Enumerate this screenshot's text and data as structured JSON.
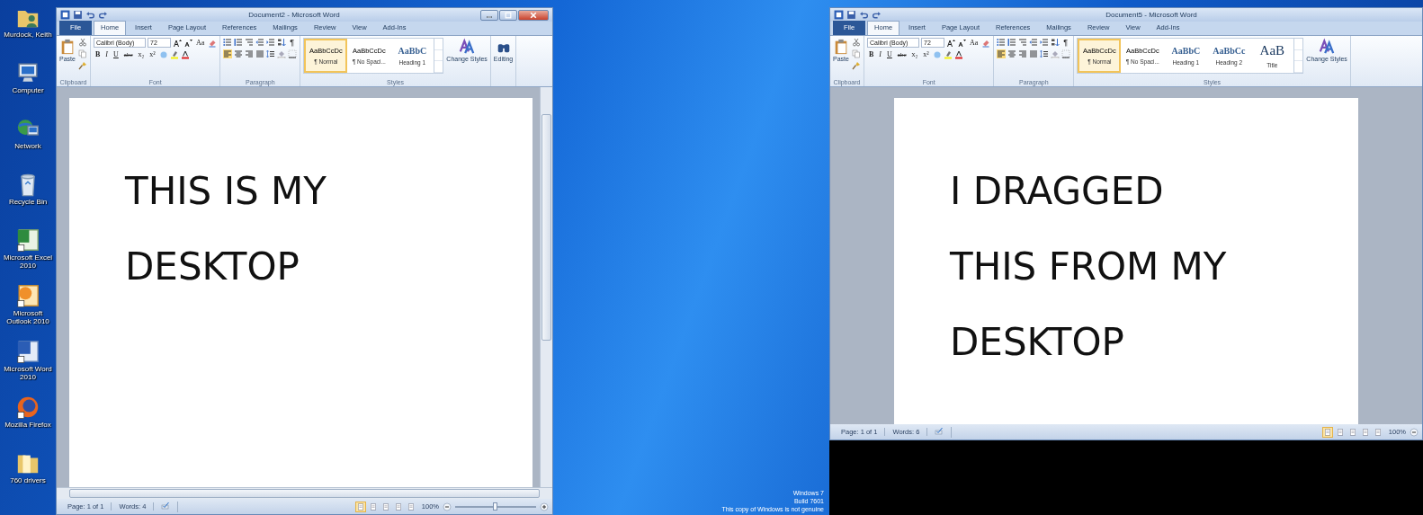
{
  "desktop": {
    "icons": [
      {
        "label": "Murdock, Keith",
        "kind": "user"
      },
      {
        "label": "Computer",
        "kind": "computer"
      },
      {
        "label": "Network",
        "kind": "network"
      },
      {
        "label": "Recycle Bin",
        "kind": "bin"
      },
      {
        "label": "Microsoft Excel 2010",
        "kind": "excel"
      },
      {
        "label": "Microsoft Outlook 2010",
        "kind": "outlook"
      },
      {
        "label": "Microsoft Word 2010",
        "kind": "word"
      },
      {
        "label": "Mozilla Firefox",
        "kind": "firefox"
      },
      {
        "label": "760 drivers",
        "kind": "folder"
      }
    ],
    "system_notice": [
      "Windows 7",
      "Build 7601",
      "This copy of Windows is not genuine"
    ]
  },
  "windows": [
    {
      "title": "Document2 - Microsoft Word",
      "window_buttons": true,
      "scrollbars": true,
      "tabs": [
        {
          "label": "File",
          "kind": "file",
          "selected": false
        },
        {
          "label": "Home",
          "kind": "tab",
          "selected": true
        },
        {
          "label": "Insert",
          "kind": "tab",
          "selected": false
        },
        {
          "label": "Page Layout",
          "kind": "tab",
          "selected": false
        },
        {
          "label": "References",
          "kind": "tab",
          "selected": false
        },
        {
          "label": "Mailings",
          "kind": "tab",
          "selected": false
        },
        {
          "label": "Review",
          "kind": "tab",
          "selected": false
        },
        {
          "label": "View",
          "kind": "tab",
          "selected": false
        },
        {
          "label": "Add-Ins",
          "kind": "tab",
          "selected": false
        }
      ],
      "ribbon": {
        "paste": "Paste",
        "font_name": "Calibri (Body)",
        "font_size": "72",
        "change_case": "Aa",
        "format_buttons": [
          "B",
          "I",
          "U",
          "abc",
          "x₂",
          "x²"
        ],
        "paragraph_mark": "¶",
        "styles": [
          {
            "preview": "AaBbCcDc",
            "name": "¶ Normal",
            "kind": "normal",
            "selected": true
          },
          {
            "preview": "AaBbCcDc",
            "name": "¶ No Spaci...",
            "kind": "normal",
            "selected": false
          },
          {
            "preview": "AaBbC",
            "name": "Heading 1",
            "kind": "heading",
            "selected": false
          }
        ],
        "change_styles": "Change Styles",
        "editing": "Editing",
        "groups": [
          "Clipboard",
          "Font",
          "Paragraph",
          "Styles"
        ]
      },
      "document": [
        "THIS IS MY",
        "DESKTOP"
      ],
      "status": {
        "page": "Page: 1 of 1",
        "words": "Words: 4",
        "zoom": "100%",
        "zoom_slider": {
          "level": 0.5
        },
        "views": [
          {
            "selected": true
          },
          {
            "selected": false
          },
          {
            "selected": false
          },
          {
            "selected": false
          },
          {
            "selected": false
          }
        ]
      }
    },
    {
      "title": "Document5 - Microsoft Word",
      "tabs": [
        {
          "label": "File",
          "kind": "file",
          "selected": false
        },
        {
          "label": "Home",
          "kind": "tab",
          "selected": true
        },
        {
          "label": "Insert",
          "kind": "tab",
          "selected": false
        },
        {
          "label": "Page Layout",
          "kind": "tab",
          "selected": false
        },
        {
          "label": "References",
          "kind": "tab",
          "selected": false
        },
        {
          "label": "Mailings",
          "kind": "tab",
          "selected": false
        },
        {
          "label": "Review",
          "kind": "tab",
          "selected": false
        },
        {
          "label": "View",
          "kind": "tab",
          "selected": false
        },
        {
          "label": "Add-Ins",
          "kind": "tab",
          "selected": false
        }
      ],
      "ribbon": {
        "paste": "Paste",
        "font_name": "Calibri (Body)",
        "font_size": "72",
        "change_case": "Aa",
        "format_buttons": [
          "B",
          "I",
          "U",
          "abc",
          "x₂",
          "x²"
        ],
        "paragraph_mark": "¶",
        "styles": [
          {
            "preview": "AaBbCcDc",
            "name": "¶ Normal",
            "kind": "normal",
            "selected": true
          },
          {
            "preview": "AaBbCcDc",
            "name": "¶ No Spaci...",
            "kind": "normal",
            "selected": false
          },
          {
            "preview": "AaBbC",
            "name": "Heading 1",
            "kind": "heading",
            "selected": false
          },
          {
            "preview": "AaBbCc",
            "name": "Heading 2",
            "kind": "heading",
            "selected": false
          },
          {
            "preview": "AaB",
            "name": "Title",
            "kind": "title",
            "selected": false
          }
        ],
        "change_styles": "Change Styles",
        "groups": [
          "Clipboard",
          "Font",
          "Paragraph",
          "Styles"
        ]
      },
      "document": [
        "I DRAGGED",
        "THIS FROM MY",
        "DESKTOP"
      ],
      "status": {
        "page": "Page: 1 of 1",
        "words": "Words: 6",
        "zoom": "100%",
        "views": [
          {
            "selected": true
          },
          {
            "selected": false
          },
          {
            "selected": false
          },
          {
            "selected": false
          },
          {
            "selected": false
          }
        ]
      }
    }
  ]
}
